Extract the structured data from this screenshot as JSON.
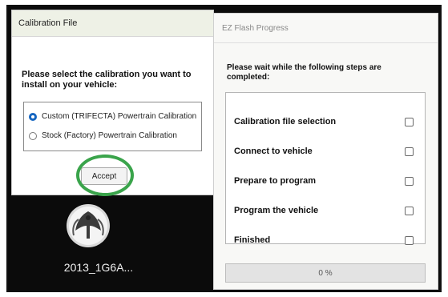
{
  "calibration_dialog": {
    "title": "Calibration File",
    "prompt": "Please select the calibration you want to install on your vehicle:",
    "options": [
      {
        "label": "Custom (TRIFECTA) Powertrain Calibration",
        "selected": true
      },
      {
        "label": "Stock (Factory) Powertrain Calibration",
        "selected": false
      }
    ],
    "accept_label": "Accept",
    "highlight_color": "#3aa44b"
  },
  "desktop": {
    "icon_name": "eagle-emblem-icon",
    "file_label": "2013_1G6A..."
  },
  "flash_dialog": {
    "title": "EZ Flash Progress",
    "prompt": "Please wait while the following steps are completed:",
    "steps": [
      {
        "label": "Calibration file selection",
        "done": false
      },
      {
        "label": "Connect to vehicle",
        "done": false
      },
      {
        "label": "Prepare to program",
        "done": false
      },
      {
        "label": "Program the vehicle",
        "done": false
      },
      {
        "label": "Finished",
        "done": false
      }
    ],
    "progress_percent": 0,
    "progress_text": "0 %"
  }
}
